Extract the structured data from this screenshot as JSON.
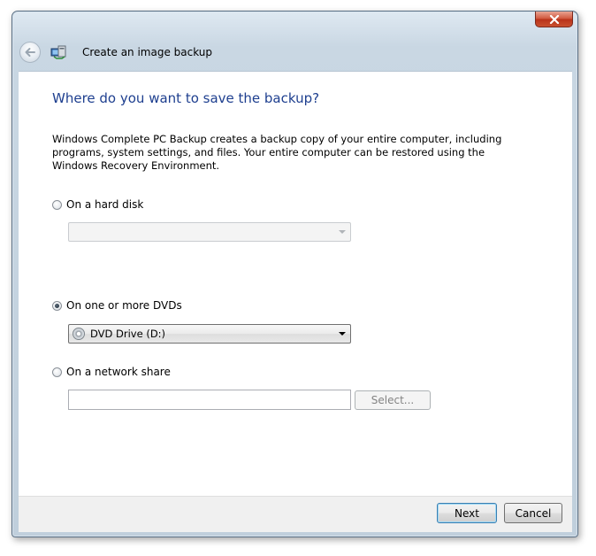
{
  "window": {
    "title": "Create an image backup",
    "close_icon": "close-icon"
  },
  "page": {
    "heading": "Where do you want to save the backup?",
    "description": "Windows Complete PC Backup creates a backup copy of your entire computer, including programs, system settings, and files. Your entire computer can be restored using the Windows Recovery Environment."
  },
  "options": {
    "hard_disk": {
      "label": "On a hard disk",
      "selected": false,
      "combo_value": "",
      "enabled": false
    },
    "dvd": {
      "label": "On one or more DVDs",
      "selected": true,
      "combo_value": "DVD Drive (D:)",
      "enabled": true
    },
    "network": {
      "label": "On a network share",
      "selected": false,
      "input_value": "",
      "select_label": "Select...",
      "enabled": false
    }
  },
  "footer": {
    "next_label": "Next",
    "cancel_label": "Cancel"
  },
  "colors": {
    "heading": "#1e3f8f",
    "frame": "#c9d7e3",
    "close": "#c9502f"
  }
}
